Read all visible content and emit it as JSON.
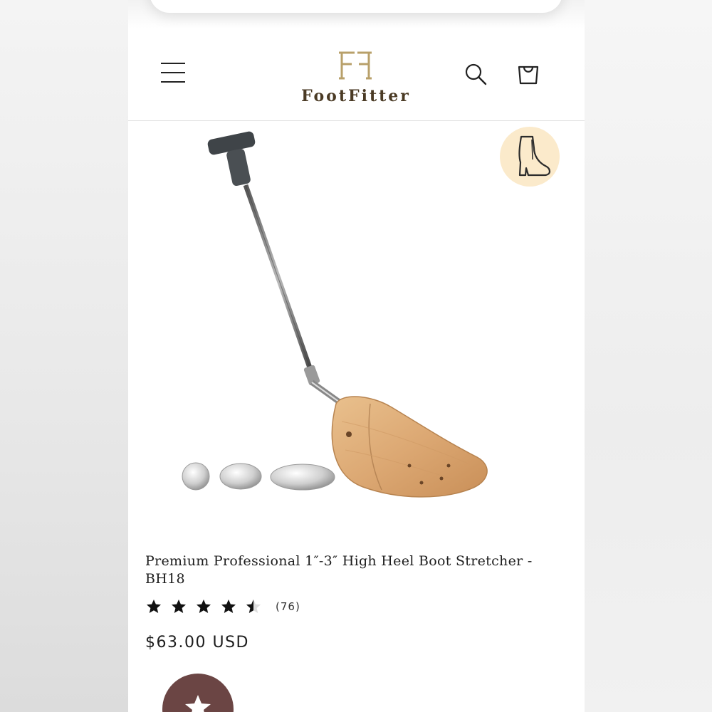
{
  "header": {
    "logo_monogram": "FF",
    "logo_text": "FootFitter"
  },
  "product": {
    "title": "Premium Professional 1″-3″ High Heel Boot Stretcher - BH18",
    "rating": 4.5,
    "rating_max": 5,
    "review_count": "(76)",
    "price": "$63.00 USD"
  },
  "colors": {
    "brand_gold": "#b8a06a",
    "brand_text": "#4a3a24",
    "badge_bg": "#fbeacb",
    "fab_bg": "#6b4544"
  },
  "icons": {
    "menu": "hamburger-menu-icon",
    "search": "search-icon",
    "cart": "shopping-bag-icon",
    "badge": "high-heel-boot-icon",
    "fab": "star-icon"
  }
}
